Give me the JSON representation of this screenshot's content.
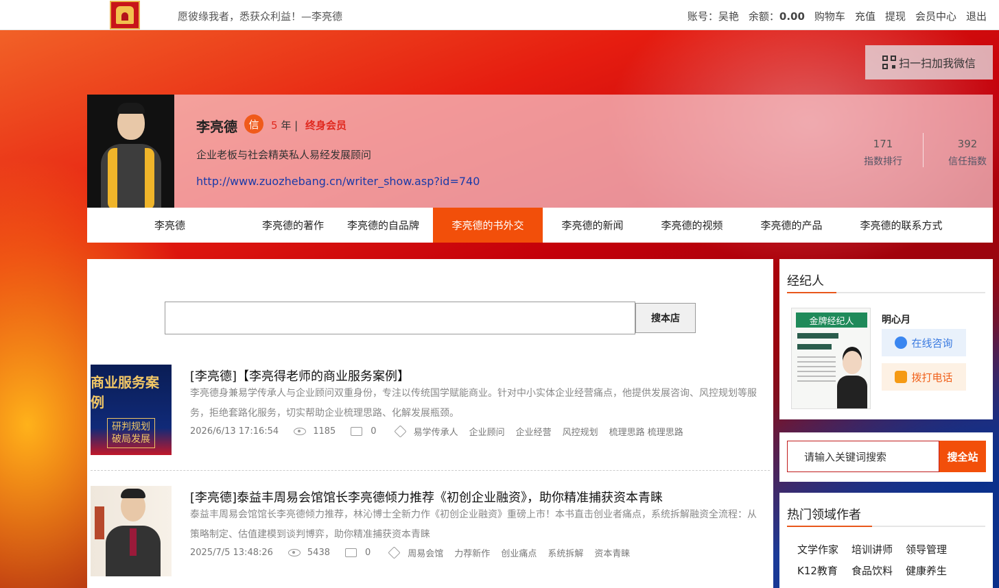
{
  "topbar": {
    "slogan": "愿彼缘我者，悉获众利益！—李亮德",
    "account_label": "账号：吴艳",
    "balance_label": "余额：",
    "balance_value": "0.00",
    "links": [
      "购物车",
      "充值",
      "提现",
      "会员中心",
      "退出"
    ]
  },
  "wechat_button": "扫一扫加我微信",
  "profile": {
    "name": "李亮德",
    "badge": "信",
    "years_num": "5",
    "years_unit": " 年 |",
    "member": "终身会员",
    "desc": "企业老板与社会精英私人易经发展顾问",
    "url": "http://www.zuozhebang.cn/writer_show.asp?id=740",
    "stats": [
      {
        "value": "171",
        "label": "指数排行"
      },
      {
        "value": "392",
        "label": "信任指数"
      }
    ]
  },
  "nav": [
    {
      "label": "李亮德",
      "active": false
    },
    {
      "label": "李亮德的著作",
      "active": false
    },
    {
      "label": "李亮德的自品牌",
      "active": false
    },
    {
      "label": "李亮德的书外交",
      "active": true
    },
    {
      "label": "李亮德的新闻",
      "active": false
    },
    {
      "label": "李亮德的视频",
      "active": false
    },
    {
      "label": "李亮德的产品",
      "active": false
    },
    {
      "label": "李亮德的联系方式",
      "active": false
    }
  ],
  "search": {
    "button": "搜本店"
  },
  "articles": [
    {
      "thumb_title": "商业服务案例",
      "thumb_sub1": "研判规划",
      "thumb_sub2": "破局发展",
      "title": "[李亮德]【李亮得老师的商业服务案例】",
      "summary": "李亮德身兼易学传承人与企业顾问双重身份，专注以传统国学赋能商业。针对中小实体企业经营痛点，他提供发展咨询、风控规划等服务，拒绝套路化服务，切实帮助企业梳理思路、化解发展瓶颈。",
      "date": "2026/6/13 17:16:54",
      "views": "1185",
      "comments": "0",
      "tags": [
        "易学传承人",
        "企业顾问",
        "企业经营",
        "风控规划",
        "梳理思路 梳理思路"
      ]
    },
    {
      "title": "[李亮德]泰益丰周易会馆馆长李亮德倾力推荐《初创企业融资》，助你精准捕获资本青睐",
      "summary": "泰益丰周易会馆馆长李亮德倾力推荐，林沁博士全新力作《初创企业融资》重磅上市！本书直击创业者痛点，系统拆解融资全流程：从策略制定、估值建模到谈判博弈，助你精准捕获资本青睐",
      "date": "2025/7/5 13:48:26",
      "views": "5438",
      "comments": "0",
      "tags": [
        "周易会馆",
        "力荐新作",
        "创业痛点",
        "系统拆解",
        "资本青睐"
      ]
    }
  ],
  "agent": {
    "title": "经纪人",
    "poster_banner": "金牌经纪人",
    "name": "明心月",
    "consult": "在线咨询",
    "call": "拨打电话"
  },
  "site_search": {
    "placeholder": "请输入关键词搜索",
    "button": "搜全站"
  },
  "hot": {
    "title": "热门领域作者",
    "cats": [
      "文学作家",
      "培训讲师",
      "领导管理",
      "K12教育",
      "食品饮料",
      "健康养生"
    ]
  }
}
